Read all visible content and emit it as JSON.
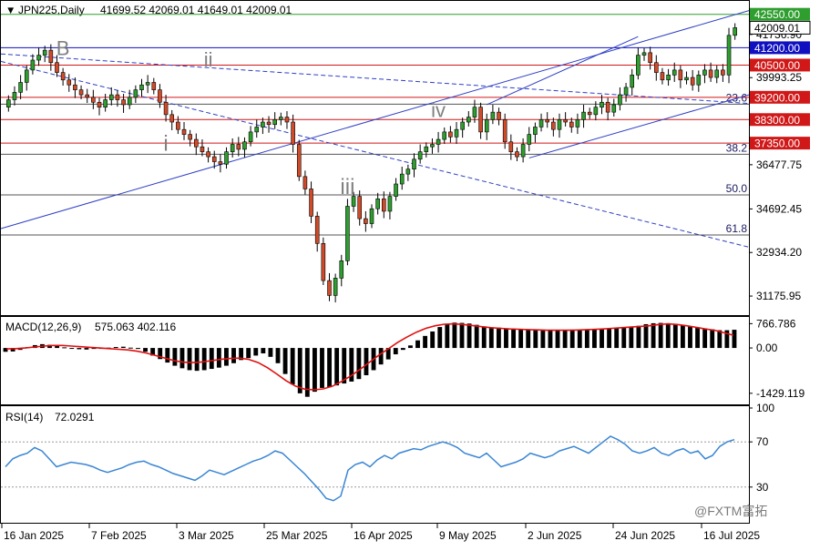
{
  "header": {
    "symbol": "JPN225,Daily",
    "ohlc": "41699.52 42069.01 41649.01 42009.01",
    "macd_label": "MACD(12,26,9)",
    "macd_values": "575.063 402.116",
    "rsi_label": "RSI(14)",
    "rsi_value": "72.0291"
  },
  "watermark": "@FXTM富拓",
  "colors": {
    "bull": "#2e9e2e",
    "bear": "#d14b2a",
    "resistance": "#d01818",
    "support_blue": "#1010c0",
    "trend": "#2e3fc4",
    "fib": "#333333",
    "signal": "#e01010",
    "rsi_line": "#3a86d4",
    "current_price_bg": "#2e9e2e",
    "level_41200_bg": "#1010c0"
  },
  "chart_data": [
    {
      "type": "candlestick",
      "title": "JPN225,Daily",
      "x_tick_labels": [
        "16 Jan 2025",
        "7 Feb 2025",
        "3 Mar 2025",
        "25 Mar 2025",
        "16 Apr 2025",
        "9 May 2025",
        "2 Jun 2025",
        "24 Jun 2025",
        "16 Jul 2025"
      ],
      "y_tick_labels": [
        "42009.01",
        "41736.90",
        "39993.25",
        "36477.75",
        "34692.45",
        "32934.20",
        "31175.95"
      ],
      "ylim": [
        30480,
        42980
      ],
      "current_price": "42009.01",
      "current_ohlc": {
        "open": 41699.52,
        "high": 42069.01,
        "low": 41649.01,
        "close": 42009.01
      },
      "horizontal_levels": [
        {
          "label": "42550.00",
          "value": 42550,
          "style": "green-box"
        },
        {
          "label": "41200.00",
          "value": 41200,
          "style": "blue-box"
        },
        {
          "label": "40500.00",
          "value": 40500,
          "style": "red-box"
        },
        {
          "label": "39200.00",
          "value": 39200,
          "style": "red-box"
        },
        {
          "label": "38300.00",
          "value": 38300,
          "style": "red-box"
        },
        {
          "label": "37350.00",
          "value": 37350,
          "style": "red-box"
        }
      ],
      "fibonacci_levels": [
        {
          "label": "23.6",
          "value": 38920
        },
        {
          "label": "38.2",
          "value": 36900
        },
        {
          "label": "50.0",
          "value": 35260
        },
        {
          "label": "61.8",
          "value": 33640
        }
      ],
      "wave_labels": [
        "B",
        "ii",
        "i",
        "iii",
        "iv"
      ],
      "closes": [
        39100,
        39400,
        39800,
        40300,
        40700,
        40900,
        41100,
        40600,
        40200,
        39900,
        39700,
        39500,
        39300,
        39200,
        39000,
        38800,
        39100,
        39300,
        39100,
        38900,
        39200,
        39500,
        39700,
        39800,
        39500,
        39000,
        38500,
        38200,
        37900,
        37700,
        37500,
        37200,
        37000,
        36800,
        36600,
        36500,
        37000,
        37300,
        37100,
        37400,
        37800,
        38000,
        38200,
        38100,
        38300,
        38400,
        38200,
        37300,
        36000,
        35500,
        34400,
        33300,
        31800,
        31200,
        31900,
        32600,
        34800,
        35200,
        34300,
        34100,
        34700,
        35100,
        34600,
        35200,
        35700,
        36100,
        36300,
        36700,
        37000,
        37200,
        37300,
        37500,
        37800,
        37600,
        37900,
        38200,
        38400,
        38800,
        37800,
        38300,
        38600,
        38300,
        37400,
        37000,
        36800,
        37300,
        37700,
        38000,
        38300,
        38200,
        37900,
        38300,
        38200,
        38000,
        38300,
        38600,
        38500,
        38800,
        39000,
        38600,
        38900,
        39300,
        39600,
        40100,
        40900,
        41000,
        40600,
        40200,
        39900,
        40100,
        40300,
        39900,
        40000,
        39700,
        40100,
        40300,
        40000,
        40300,
        40100,
        41700,
        42009
      ]
    },
    {
      "type": "histogram-line",
      "title": "MACD(12,26,9)",
      "y_tick_labels": [
        "766.786",
        "0.00",
        "-1429.119"
      ],
      "ylim": [
        -1750,
        950
      ],
      "histogram": [
        -120,
        -110,
        -60,
        30,
        90,
        120,
        100,
        60,
        20,
        -10,
        -40,
        -50,
        -30,
        -20,
        10,
        30,
        40,
        10,
        -30,
        -120,
        -240,
        -350,
        -460,
        -560,
        -640,
        -700,
        -720,
        -700,
        -660,
        -620,
        -560,
        -480,
        -380,
        -320,
        -240,
        -170,
        -280,
        -480,
        -820,
        -1150,
        -1430,
        -1540,
        -1380,
        -1260,
        -1240,
        -1180,
        -1120,
        -1060,
        -980,
        -860,
        -700,
        -520,
        -360,
        -200,
        -60,
        80,
        240,
        380,
        520,
        660,
        760,
        800,
        790,
        770,
        730,
        680,
        650,
        640,
        620,
        600,
        590,
        580,
        570,
        560,
        560,
        555,
        550,
        560,
        570,
        580,
        590,
        600,
        610,
        620,
        640,
        660,
        700,
        750,
        780,
        790,
        780,
        760,
        730,
        690,
        650,
        620,
        590,
        560,
        560,
        575
      ],
      "signal": [
        -30,
        -20,
        0,
        30,
        60,
        80,
        80,
        60,
        40,
        20,
        0,
        -20,
        -40,
        -60,
        -100,
        -160,
        -240,
        -320,
        -400,
        -450,
        -460,
        -440,
        -400,
        -360,
        -330,
        -320,
        -360,
        -460,
        -620,
        -820,
        -1030,
        -1200,
        -1300,
        -1320,
        -1290,
        -1200,
        -1050,
        -870,
        -660,
        -440,
        -220,
        -20,
        180,
        350,
        500,
        620,
        700,
        750,
        760,
        740,
        710,
        670,
        640,
        620,
        600,
        590,
        580,
        570,
        560,
        560,
        560,
        565,
        575,
        585,
        600,
        620,
        640,
        660,
        680,
        700,
        740,
        760,
        740,
        700,
        650,
        600,
        560,
        480,
        402
      ]
    },
    {
      "type": "line",
      "title": "RSI(14)",
      "y_tick_labels": [
        "100",
        "70",
        "30"
      ],
      "ylim": [
        0,
        100
      ],
      "guides": [
        70,
        30
      ],
      "values": [
        48,
        55,
        58,
        60,
        65,
        62,
        55,
        48,
        50,
        52,
        51,
        50,
        48,
        45,
        43,
        45,
        47,
        50,
        52,
        53,
        50,
        48,
        45,
        42,
        40,
        38,
        36,
        40,
        45,
        43,
        41,
        44,
        47,
        50,
        53,
        55,
        58,
        62,
        60,
        54,
        48,
        42,
        35,
        28,
        20,
        18,
        22,
        45,
        50,
        52,
        48,
        54,
        58,
        55,
        60,
        62,
        64,
        63,
        66,
        68,
        70,
        68,
        65,
        60,
        58,
        56,
        60,
        54,
        48,
        50,
        52,
        55,
        60,
        58,
        56,
        58,
        62,
        64,
        66,
        63,
        60,
        65,
        70,
        75,
        72,
        68,
        62,
        60,
        62,
        65,
        60,
        58,
        62,
        64,
        60,
        62,
        55,
        58,
        66,
        70,
        72
      ]
    }
  ]
}
